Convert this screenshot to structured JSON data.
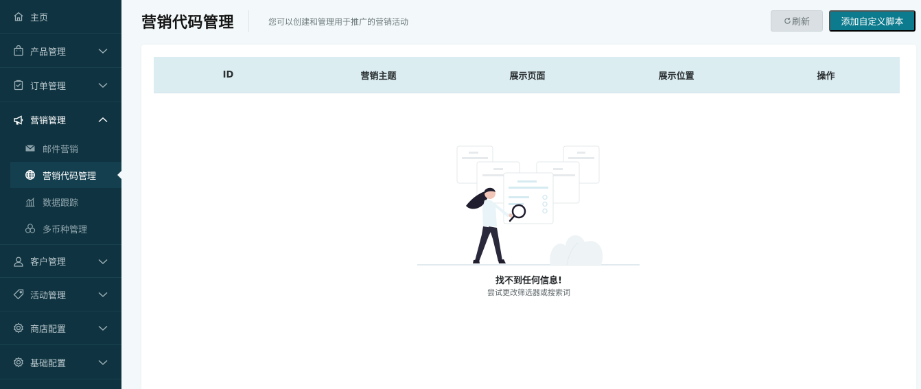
{
  "sidebar": {
    "items": [
      {
        "label": "主页",
        "icon": "home-icon"
      },
      {
        "label": "产品管理",
        "icon": "shopping-bag-icon"
      },
      {
        "label": "订单管理",
        "icon": "clipboard-icon"
      },
      {
        "label": "营销管理",
        "icon": "megaphone-icon",
        "open": true
      },
      {
        "label": "客户管理",
        "icon": "user-icon"
      },
      {
        "label": "活动管理",
        "icon": "tag-icon"
      },
      {
        "label": "商店配置",
        "icon": "gear-icon"
      },
      {
        "label": "基础配置",
        "icon": "gear-icon"
      }
    ],
    "sub_items": [
      {
        "label": "邮件营销",
        "icon": "mail-icon"
      },
      {
        "label": "营销代码管理",
        "icon": "globe-icon",
        "active": true
      },
      {
        "label": "数据跟踪",
        "icon": "bar-chart-icon"
      },
      {
        "label": "多币种管理",
        "icon": "coins-icon"
      }
    ]
  },
  "header": {
    "title": "营销代码管理",
    "description": "您可以创建和管理用于推广的营销活动",
    "refresh_label": "刷新",
    "add_label": "添加自定义脚本"
  },
  "table": {
    "columns": [
      "ID",
      "营销主题",
      "展示页面",
      "展示位置",
      "操作"
    ],
    "rows": []
  },
  "empty": {
    "title": "找不到任何信息!",
    "subtitle": "尝试更改筛选器或搜索词"
  },
  "colors": {
    "sidebar_bg": "#0f3340",
    "accent": "#0c7b8e",
    "table_header_bg": "#dcedf2",
    "page_bg": "#f3f9fa"
  }
}
